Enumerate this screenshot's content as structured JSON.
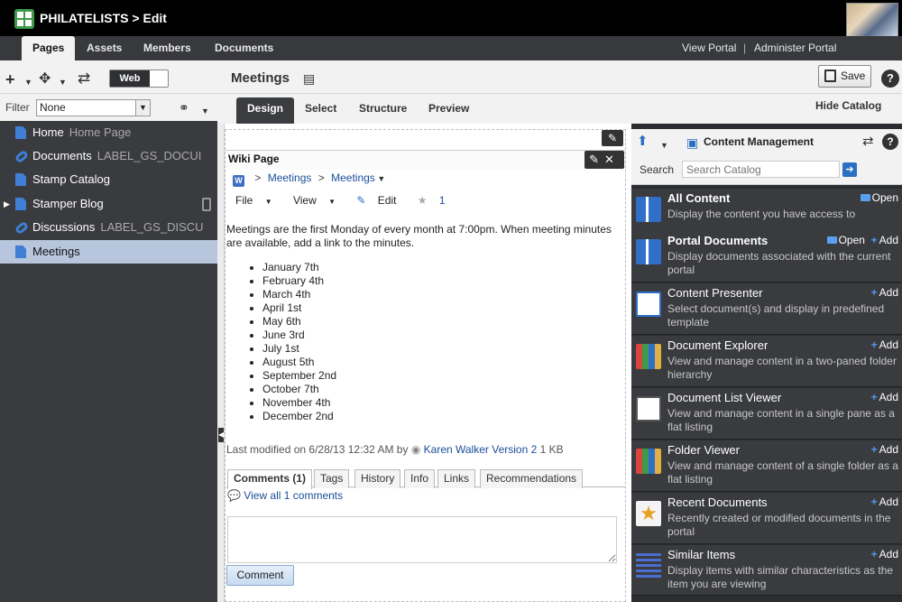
{
  "app": {
    "title": "PHILATELISTS > Edit"
  },
  "top_tabs": [
    {
      "label": "Pages"
    },
    {
      "label": "Assets"
    },
    {
      "label": "Members"
    },
    {
      "label": "Documents"
    }
  ],
  "top_links": {
    "view_portal": "View Portal",
    "separator": "|",
    "administer_portal": "Administer Portal"
  },
  "toolbar": {
    "view_mode": "Web",
    "page_heading": "Meetings",
    "save_label": "Save",
    "help": "?"
  },
  "left_panel": {
    "filter_label": "Filter",
    "filter_value": "None",
    "items": [
      {
        "label": "Home",
        "sub": "Home Page",
        "icon": "page-icon"
      },
      {
        "label": "Documents",
        "sub": "LABEL_GS_DOCUI",
        "icon": "link-icon"
      },
      {
        "label": "Stamp Catalog",
        "sub": "",
        "icon": "page-icon"
      },
      {
        "label": "Stamper Blog",
        "sub": "",
        "icon": "page-icon"
      },
      {
        "label": "Discussions",
        "sub": "LABEL_GS_DISCU",
        "icon": "link-icon"
      },
      {
        "label": "Meetings",
        "sub": "",
        "icon": "page-icon"
      }
    ]
  },
  "design_tabs": [
    {
      "label": "Design"
    },
    {
      "label": "Select"
    },
    {
      "label": "Structure"
    },
    {
      "label": "Preview"
    }
  ],
  "hide_catalog": "Hide Catalog",
  "wiki": {
    "portlet_title": "Wiki Page",
    "breadcrumb": [
      "Meetings",
      "Meetings"
    ],
    "crumb_sep": ">",
    "menu": {
      "file": "File",
      "view": "View",
      "edit": "Edit",
      "rating": "1"
    },
    "body": "Meetings are the first Monday of every month at 7:00pm. When meeting minutes are available, add a link to the minutes.",
    "dates": [
      "January 7th",
      "February 4th",
      "March 4th",
      "April 1st",
      "May 6th",
      "June 3rd",
      "July 1st",
      "August 5th",
      "September 2nd",
      "October 7th",
      "November 4th",
      "December 2nd"
    ],
    "modified_prefix": "Last modified on 6/28/13 12:32 AM  by",
    "modified_author": "Karen Walker",
    "modified_version": "Version 2",
    "modified_size": "1 KB",
    "tabs": [
      "Comments (1)",
      "Tags",
      "History",
      "Info",
      "Links",
      "Recommendations"
    ],
    "view_all": "View all 1 comments",
    "comment_button": "Comment"
  },
  "catalog": {
    "title": "Content Management",
    "search_label": "Search",
    "search_placeholder": "Search Catalog",
    "items": [
      {
        "name": "All Content",
        "desc": "Display the content you have access to",
        "open": "Open",
        "add": ""
      },
      {
        "name": "Portal Documents",
        "desc": "Display documents associated with the current portal",
        "open": "Open",
        "add": "Add"
      },
      {
        "name": "Content Presenter",
        "desc": "Select document(s) and display in predefined template",
        "open": "",
        "add": "Add"
      },
      {
        "name": "Document Explorer",
        "desc": "View and manage content in a two-paned folder hierarchy",
        "open": "",
        "add": "Add"
      },
      {
        "name": "Document List Viewer",
        "desc": "View and manage content in a single pane as a flat listing",
        "open": "",
        "add": "Add"
      },
      {
        "name": "Folder Viewer",
        "desc": "View and manage content of a single folder as a flat listing",
        "open": "",
        "add": "Add"
      },
      {
        "name": "Recent Documents",
        "desc": "Recently created or modified documents in the portal",
        "open": "",
        "add": "Add"
      },
      {
        "name": "Similar Items",
        "desc": "Display items with similar characteristics as the item you are viewing",
        "open": "",
        "add": "Add"
      }
    ]
  },
  "colors": {
    "accent": "#3f7fd6",
    "dark_panel": "#3a3b3f",
    "selected": "#b7c6dc",
    "link": "#1b4f9b"
  }
}
